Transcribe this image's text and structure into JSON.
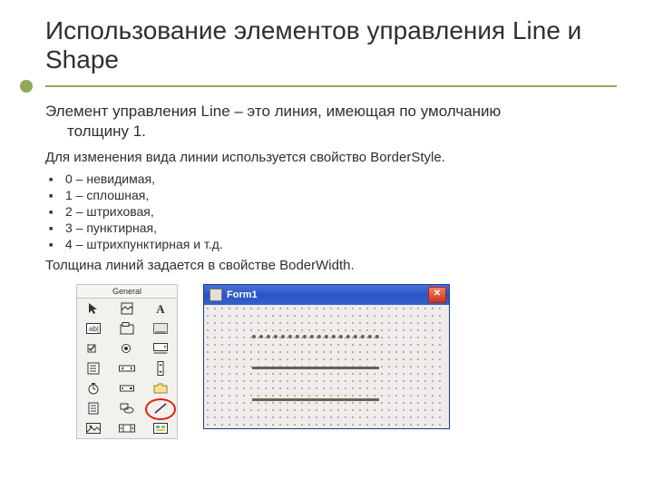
{
  "title": "Использование элементов управления Line и Shape",
  "lead_a": "Элемент управления Line – это линия, имеющая по умолчанию",
  "lead_b": "толщину 1.",
  "subhead": "Для изменения вида  линии используется свойство BorderStyle.",
  "bullets": [
    "0 – невидимая,",
    "1 – сплошная,",
    "2 – штриховая,",
    "3 – пунктирная,",
    "4 – штрихпунктирная и т.д."
  ],
  "note": "Толщина линий задается в свойстве BoderWidth.",
  "toolbox": {
    "tab": "General"
  },
  "form": {
    "title": "Form1",
    "close": "✕"
  }
}
